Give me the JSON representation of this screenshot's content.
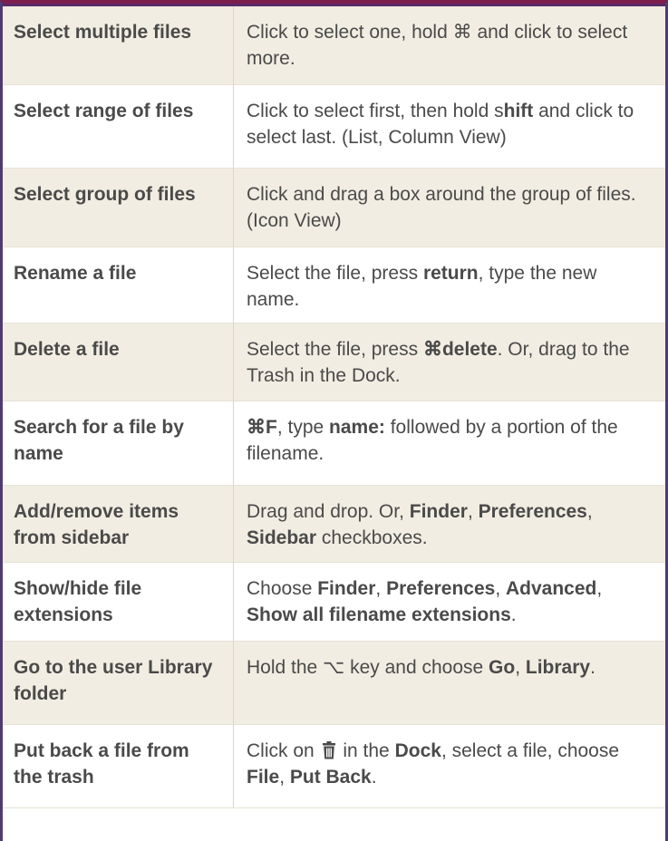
{
  "rows": [
    {
      "action": "Select multiple files",
      "desc": [
        "Click to select one, hold ⌘ and click to select more."
      ]
    },
    {
      "action": "Select range of files",
      "desc": [
        "Click to select first, then hold s",
        {
          "b": "hift"
        },
        " and click to select last. (List, Column View)"
      ]
    },
    {
      "action": "Select group of files",
      "desc": [
        "Click and drag a box around the group of files. (Icon View)"
      ]
    },
    {
      "action": "Rename a file",
      "desc": [
        "Select the file, press ",
        {
          "b": "return"
        },
        ", type the new name."
      ]
    },
    {
      "action": "Delete a file",
      "desc": [
        "Select the file, press ",
        {
          "b": "⌘delete"
        },
        ". Or, drag to the Trash in the Dock."
      ]
    },
    {
      "action": "Search for a file by name",
      "desc": [
        {
          "b": "⌘F"
        },
        ", type ",
        {
          "b": "name:"
        },
        " followed by a portion of the filename."
      ]
    },
    {
      "action": "Add/remove items from sidebar",
      "desc": [
        "Drag and drop. Or, ",
        {
          "b": "Finder"
        },
        ", ",
        {
          "b": "Preferences"
        },
        ", ",
        {
          "b": "Sidebar"
        },
        " checkboxes."
      ]
    },
    {
      "action": "Show/hide file extensions",
      "desc": [
        "Choose ",
        {
          "b": "Finder"
        },
        ", ",
        {
          "b": "Preferences"
        },
        ", ",
        {
          "b": "Advanced"
        },
        ", ",
        {
          "b": "Show all filename extensions"
        },
        "."
      ]
    },
    {
      "action": "Go to the user Library folder",
      "desc": [
        "Hold the ⌥ key and choose ",
        {
          "b": "Go"
        },
        ", ",
        {
          "b": "Library"
        },
        "."
      ]
    },
    {
      "action": "Put back a file from the trash",
      "desc": [
        "Click on ",
        {
          "icon": "trash-icon"
        },
        " in the ",
        {
          "b": "Dock"
        },
        ", select a file, choose ",
        {
          "b": "File"
        },
        ", ",
        {
          "b": "Put Back"
        },
        "."
      ]
    }
  ],
  "colors": {
    "top_band": "#5a2a66",
    "side_border": "#4e3b74",
    "shaded_row": "#f2ede2",
    "text": "#4a4a4a"
  }
}
